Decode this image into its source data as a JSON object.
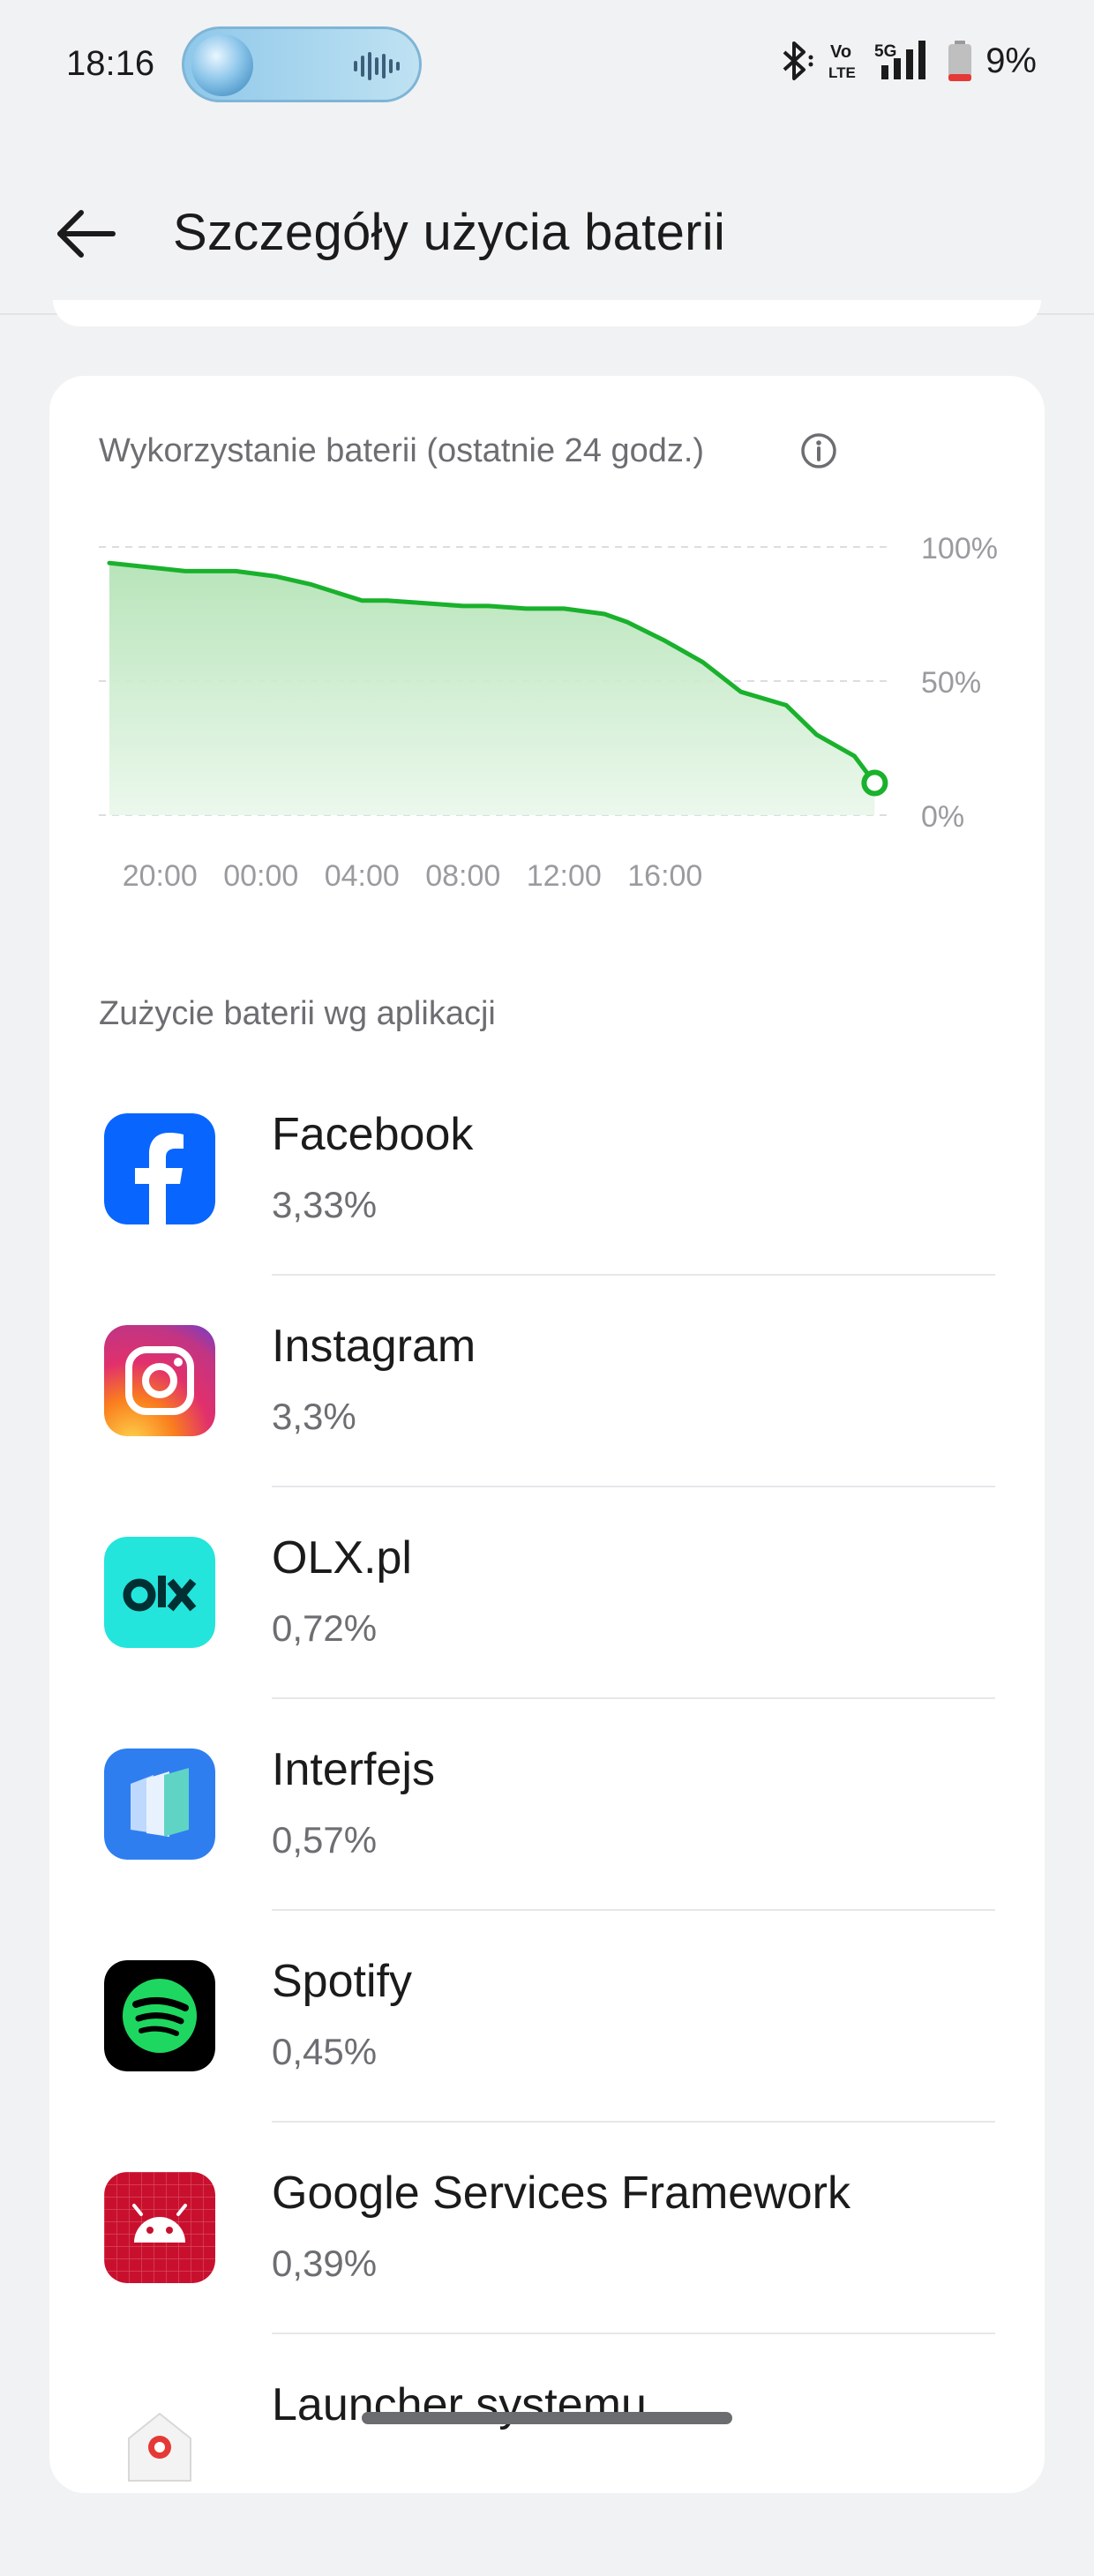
{
  "status_bar": {
    "time": "18:16",
    "battery_percent": "9%",
    "network": "5G",
    "volte": "Vo LTE",
    "icons": [
      "media-pill-icon",
      "bluetooth-icon",
      "volte-icon",
      "signal-5g-icon",
      "battery-low-icon"
    ]
  },
  "header": {
    "title": "Szczegóły użycia baterii",
    "back_icon": "back-arrow-icon"
  },
  "usage_chart": {
    "title": "Wykorzystanie baterii (ostatnie 24 godz.)",
    "info_icon": "info-icon"
  },
  "chart_data": {
    "type": "area",
    "title": "Wykorzystanie baterii (ostatnie 24 godz.)",
    "x_tick_labels": [
      "20:00",
      "00:00",
      "04:00",
      "08:00",
      "12:00",
      "16:00"
    ],
    "y_tick_labels": [
      "100%",
      "50%",
      "0%"
    ],
    "ylim": [
      0,
      100
    ],
    "x_hours": [
      -6.0,
      -3.0,
      -1.0,
      0.6,
      2.0,
      4.0,
      5.0,
      6.5,
      8.0,
      9.0,
      10.5,
      12.0,
      13.6,
      14.5,
      16.0,
      17.5,
      19.0,
      20.8,
      22.0,
      23.5,
      24.3
    ],
    "values": [
      94,
      91,
      91,
      89,
      86,
      80,
      80,
      79,
      78,
      78,
      77,
      77,
      75,
      72,
      65,
      57,
      46,
      41,
      30,
      22,
      12
    ],
    "line_color": "#1ab12c",
    "fill_color": "#c8ecc9",
    "grid": true,
    "end_marker": true
  },
  "app_section": {
    "label": "Zużycie baterii wg aplikacji"
  },
  "apps": [
    {
      "name": "Facebook",
      "percent": "3,33%",
      "icon": "facebook-icon"
    },
    {
      "name": "Instagram",
      "percent": "3,3%",
      "icon": "instagram-icon"
    },
    {
      "name": "OLX.pl",
      "percent": "0,72%",
      "icon": "olx-icon"
    },
    {
      "name": "Interfejs",
      "percent": "0,57%",
      "icon": "interfejs-icon"
    },
    {
      "name": "Spotify",
      "percent": "0,45%",
      "icon": "spotify-icon"
    },
    {
      "name": "Google Services Framework",
      "percent": "0,39%",
      "icon": "android-icon"
    },
    {
      "name": "Launcher systemu",
      "percent": "",
      "icon": "launcher-icon"
    }
  ],
  "colors": {
    "accent_green": "#1ab12c",
    "background": "#f1f2f4",
    "card": "#ffffff",
    "secondary_text": "#6d6e72"
  }
}
